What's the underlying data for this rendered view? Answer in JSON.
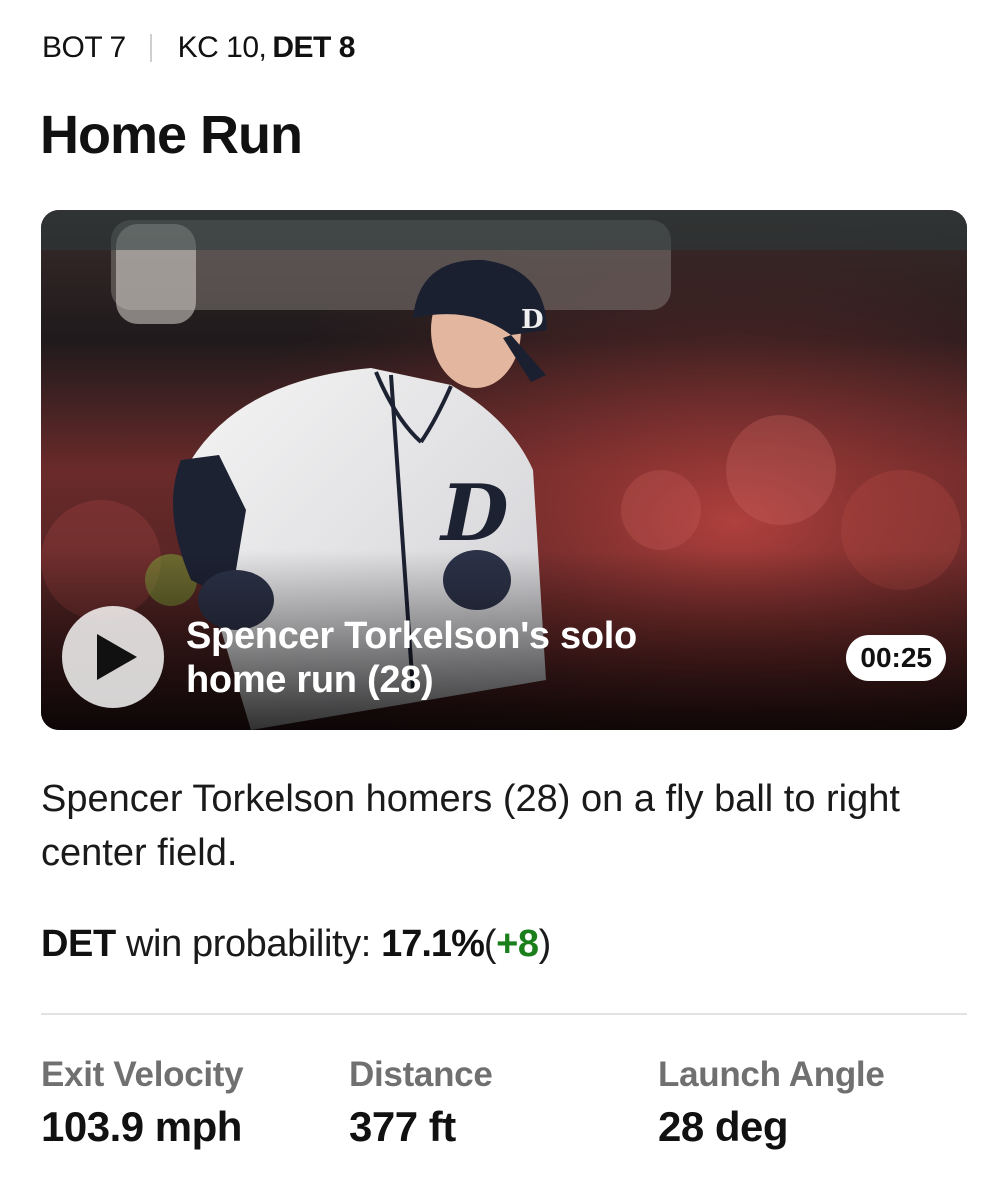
{
  "header": {
    "inning": "BOT 7",
    "away_score": "KC 10,",
    "home_score": "DET 8"
  },
  "title": "Home Run",
  "video": {
    "title": "Spencer Torkelson's solo home run (28)",
    "duration": "00:25",
    "play_icon": "play-icon"
  },
  "description": "Spencer Torkelson homers (28) on a fly ball to right center field.",
  "win_probability": {
    "team": "DET",
    "label": "win probability:",
    "value": "17.1%",
    "open_paren": "(",
    "delta": "+8",
    "close_paren": ")"
  },
  "stats": {
    "exit_velocity": {
      "label": "Exit Velocity",
      "value": "103.9 mph"
    },
    "distance": {
      "label": "Distance",
      "value": "377 ft"
    },
    "launch_angle": {
      "label": "Launch Angle",
      "value": "28 deg"
    }
  },
  "colors": {
    "delta_positive": "#1a7f1a",
    "stat_label": "#707070",
    "divider": "#e2e2e2"
  }
}
